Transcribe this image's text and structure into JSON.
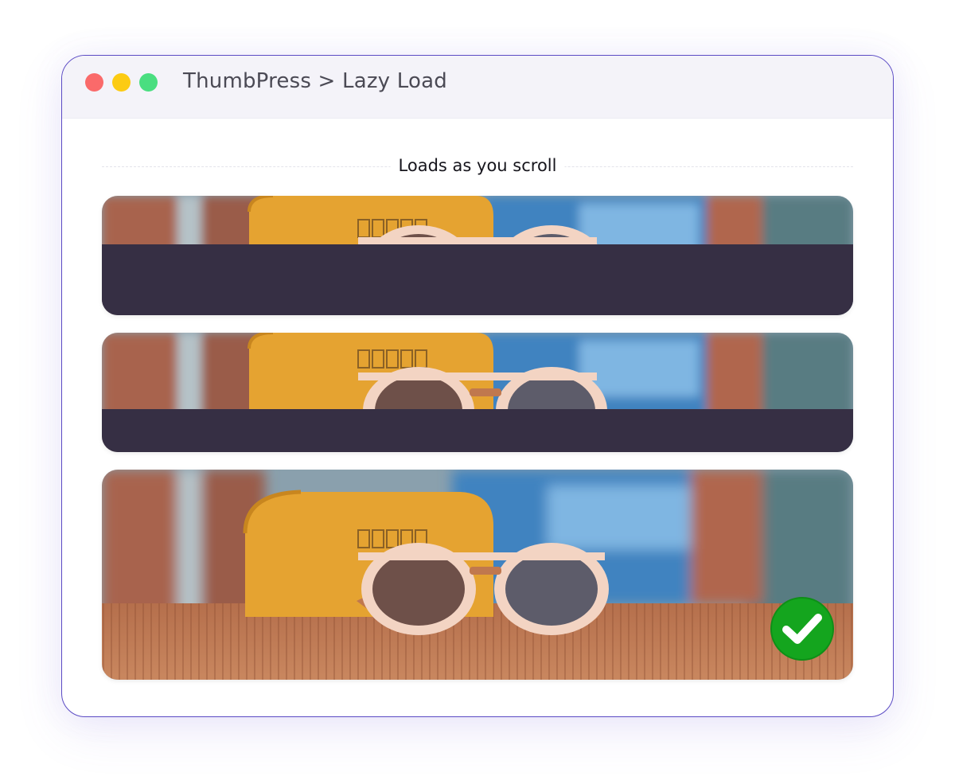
{
  "window": {
    "title": "ThumbPress > Lazy Load",
    "controls": [
      "close-dot",
      "minimize-dot",
      "maximize-dot"
    ]
  },
  "section": {
    "label": "Loads as you scroll"
  },
  "cards": [
    {
      "state": "partially-loaded",
      "loaded_fraction": 0.4
    },
    {
      "state": "partially-loaded",
      "loaded_fraction": 0.64
    },
    {
      "state": "loaded",
      "loaded_fraction": 1.0,
      "badge": "check-icon"
    }
  ],
  "colors": {
    "accent_border": "#5b4bc4",
    "placeholder": "#362f44",
    "success": "#14a51e",
    "dot_red": "#fa6a6a",
    "dot_yellow": "#fccb13",
    "dot_green": "#4ade80"
  }
}
